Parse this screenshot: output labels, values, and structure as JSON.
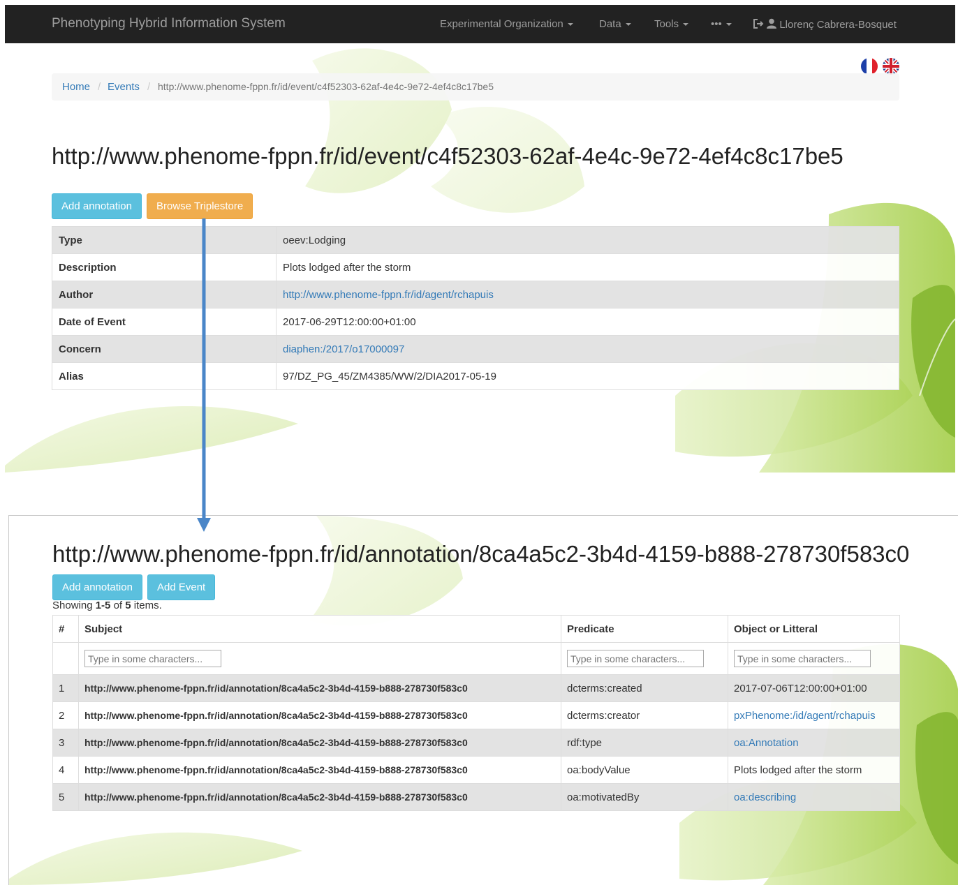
{
  "navbar": {
    "brand": "Phenotyping Hybrid Information System",
    "menus": [
      "Experimental Organization",
      "Data",
      "Tools",
      "•••"
    ],
    "user": "Llorenç Cabrera-Bosquet"
  },
  "breadcrumb": {
    "home": "Home",
    "events": "Events",
    "current": "http://www.phenome-fppn.fr/id/event/c4f52303-62af-4e4c-9e72-4ef4c8c17be5"
  },
  "event": {
    "title": "http://www.phenome-fppn.fr/id/event/c4f52303-62af-4e4c-9e72-4ef4c8c17be5",
    "buttons": {
      "add_annotation": "Add annotation",
      "browse_triplestore": "Browse Triplestore"
    },
    "details": [
      {
        "key": "Type",
        "value": "oeev:Lodging",
        "is_link": false
      },
      {
        "key": "Description",
        "value": "Plots lodged after the storm",
        "is_link": false
      },
      {
        "key": "Author",
        "value": "http://www.phenome-fppn.fr/id/agent/rchapuis",
        "is_link": true
      },
      {
        "key": "Date of Event",
        "value": "2017-06-29T12:00:00+01:00",
        "is_link": false
      },
      {
        "key": "Concern",
        "value": "diaphen:/2017/o17000097",
        "is_link": true
      },
      {
        "key": "Alias",
        "value": "97/DZ_PG_45/ZM4385/WW/2/DIA2017-05-19",
        "is_link": false
      }
    ]
  },
  "annotation": {
    "title": "http://www.phenome-fppn.fr/id/annotation/8ca4a5c2-3b4d-4159-b888-278730f583c0",
    "buttons": {
      "add_annotation": "Add annotation",
      "add_event": "Add Event"
    },
    "summary": {
      "prefix": "Showing ",
      "range": "1-5",
      "middle": " of ",
      "total": "5",
      "suffix": " items."
    },
    "columns": {
      "num": "#",
      "subject": "Subject",
      "predicate": "Predicate",
      "object": "Object or Litteral"
    },
    "filter_placeholder": "Type in some characters...",
    "rows": [
      {
        "num": "1",
        "subject": "http://www.phenome-fppn.fr/id/annotation/8ca4a5c2-3b4d-4159-b888-278730f583c0",
        "predicate": "dcterms:created",
        "object": "2017-07-06T12:00:00+01:00",
        "object_is_link": false
      },
      {
        "num": "2",
        "subject": "http://www.phenome-fppn.fr/id/annotation/8ca4a5c2-3b4d-4159-b888-278730f583c0",
        "predicate": "dcterms:creator",
        "object": "pxPhenome:/id/agent/rchapuis",
        "object_is_link": true
      },
      {
        "num": "3",
        "subject": "http://www.phenome-fppn.fr/id/annotation/8ca4a5c2-3b4d-4159-b888-278730f583c0",
        "predicate": "rdf:type",
        "object": "oa:Annotation",
        "object_is_link": true
      },
      {
        "num": "4",
        "subject": "http://www.phenome-fppn.fr/id/annotation/8ca4a5c2-3b4d-4159-b888-278730f583c0",
        "predicate": "oa:bodyValue",
        "object": "Plots lodged after the storm",
        "object_is_link": false
      },
      {
        "num": "5",
        "subject": "http://www.phenome-fppn.fr/id/annotation/8ca4a5c2-3b4d-4159-b888-278730f583c0",
        "predicate": "oa:motivatedBy",
        "object": "oa:describing",
        "object_is_link": true
      }
    ]
  },
  "colors": {
    "navbar": "#222222",
    "link": "#337ab7",
    "btn_info": "#5bc0de",
    "btn_warning": "#f0ad4e",
    "arrow": "#4a86c8"
  },
  "icons": [
    "logout-icon",
    "user-icon",
    "french-flag-icon",
    "uk-flag-icon",
    "arrow-down-icon"
  ]
}
